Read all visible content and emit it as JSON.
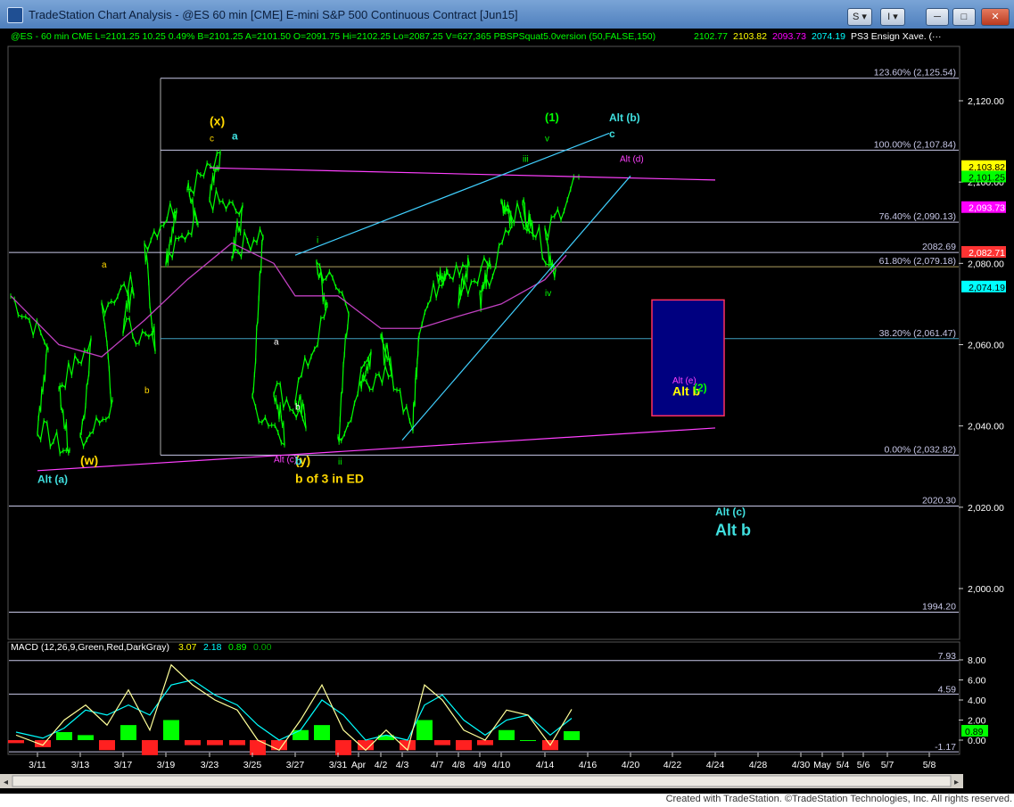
{
  "window": {
    "title": "TradeStation Chart Analysis - @ES 60 min [CME] E-mini S&P 500 Continuous Contract [Jun15]",
    "buttons": {
      "s_label": "S",
      "i_label": "I"
    },
    "colors": {
      "titlebar": "#5b8bc7",
      "background": "#000000"
    }
  },
  "status_line": [
    {
      "text": "@ES - 60 min  CME  L=2101.25  10.25  0.49%  B=2101.25  A=2101.50  O=2091.75  Hi=2102.25  Lo=2087.25  V=627,365  PBSPSquat5.0version (50,FALSE,150)",
      "color": "#00ff00"
    },
    {
      "text": "2102.77",
      "color": "#00ff00"
    },
    {
      "text": "2103.82",
      "color": "#ffff00"
    },
    {
      "text": "2093.73",
      "color": "#ff00ff"
    },
    {
      "text": "2074.19",
      "color": "#00ffff"
    },
    {
      "text": "PS3 Ensign Xave. (···",
      "color": "#ffffff"
    }
  ],
  "chart_data": [
    {
      "type": "candlestick-line",
      "title": "@ES 60 min [CME] E-mini S&P 500 Continuous Contract [Jun15]",
      "ylim": [
        1990,
        2135
      ],
      "y_ticks": [
        2000,
        2020,
        2040,
        2060,
        2080,
        2100,
        2120
      ],
      "y_tick_labels": [
        "2,000.00",
        "2,020.00",
        "2,040.00",
        "2,060.00",
        "2,080.00",
        "2,100.00",
        "2,120.00"
      ],
      "x_ticks": [
        "3/11",
        "3/13",
        "3/17",
        "3/19",
        "3/23",
        "3/25",
        "3/27",
        "3/31",
        "Apr",
        "4/2",
        "4/3",
        "4/7",
        "4/8",
        "4/9",
        "4/10",
        "4/14",
        "4/16",
        "4/20",
        "4/22",
        "4/24",
        "4/28",
        "4/30",
        "May",
        "5/4",
        "5/6",
        "5/7",
        "5/8"
      ],
      "price_path": {
        "x": [
          "3/10",
          "3/11",
          "3/11",
          "3/12",
          "3/12",
          "3/13",
          "3/13",
          "3/16",
          "3/16",
          "3/17",
          "3/17",
          "3/18",
          "3/18",
          "3/19",
          "3/19",
          "3/20",
          "3/20",
          "3/23",
          "3/23",
          "3/24",
          "3/24",
          "3/25",
          "3/25",
          "3/26",
          "3/26",
          "3/27",
          "3/27",
          "3/30",
          "3/30",
          "3/31",
          "3/31",
          "4/1",
          "4/1",
          "4/2",
          "4/2",
          "4/3",
          "4/6",
          "4/7",
          "4/7",
          "4/8",
          "4/8",
          "4/9",
          "4/9",
          "4/10",
          "4/10",
          "4/13",
          "4/13",
          "4/14",
          "4/14",
          "4/15"
        ],
        "y": [
          2072,
          2060,
          2040,
          2033,
          2050,
          2060,
          2035,
          2045,
          2070,
          2075,
          2065,
          2060,
          2085,
          2095,
          2080,
          2092,
          2098,
          2105,
          2096,
          2092,
          2083,
          2088,
          2045,
          2038,
          2050,
          2041,
          2048,
          2068,
          2080,
          2070,
          2035,
          2058,
          2050,
          2055,
          2060,
          2040,
          2065,
          2080,
          2075,
          2080,
          2072,
          2082,
          2070,
          2090,
          2096,
          2088,
          2094,
          2078,
          2086,
          2101.25
        ]
      },
      "moving_average": {
        "name": "PBSPSquat5.0version (50,FALSE,150)",
        "x": [
          "3/10",
          "3/12",
          "3/16",
          "3/18",
          "3/20",
          "3/24",
          "3/26",
          "3/27",
          "3/31",
          "4/2",
          "4/6",
          "4/8",
          "4/10",
          "4/14",
          "4/15"
        ],
        "y": [
          2072,
          2060,
          2057,
          2066,
          2076,
          2085,
          2080,
          2072,
          2072,
          2064,
          2064,
          2067,
          2070,
          2076,
          2082
        ]
      },
      "fib_levels": [
        {
          "label": "123.60% (2,125.54)",
          "value": 2125.54
        },
        {
          "label": "100.00% (2,107.84)",
          "value": 2107.84
        },
        {
          "label": "76.40% (2,090.13)",
          "value": 2090.13
        },
        {
          "label": "61.80% (2,079.18)",
          "value": 2079.18
        },
        {
          "label": "38.20% (2,061.47)",
          "value": 2061.47
        },
        {
          "label": "0.00% (2,032.82)",
          "value": 2032.82
        }
      ],
      "horizontal_levels": [
        {
          "label": "2082.69",
          "value": 2082.69
        },
        {
          "label": "2020.30",
          "value": 2020.3
        },
        {
          "label": "1994.20",
          "value": 1994.2
        }
      ],
      "trendlines": [
        {
          "color": "#ff40ff",
          "from": [
            "3/23",
            2103.5
          ],
          "to": [
            "4/24",
            2100.5
          ]
        },
        {
          "color": "#ff40ff",
          "from": [
            "3/11",
            2029
          ],
          "to": [
            "4/24",
            2039.5
          ]
        },
        {
          "color": "#40d0ff",
          "from": [
            "3/27",
            2082
          ],
          "to": [
            "4/17",
            2112
          ]
        },
        {
          "color": "#40d0ff",
          "from": [
            "4/3",
            2036.5
          ],
          "to": [
            "4/20",
            2101.5
          ]
        }
      ],
      "target_box": {
        "x": [
          "4/21",
          "4/25"
        ],
        "y": [
          2042.5,
          2071
        ],
        "fill": "#000080",
        "border": "#ff3060"
      },
      "price_tags": [
        {
          "label": "2,103.82",
          "value": 2103.82,
          "bg": "#ffff00",
          "fg": "#000000"
        },
        {
          "label": "2,101.25",
          "value": 2101.25,
          "bg": "#00ff00",
          "fg": "#000000"
        },
        {
          "label": "2,093.73",
          "value": 2093.73,
          "bg": "#ff00ff",
          "fg": "#ffffff"
        },
        {
          "label": "2,082.71",
          "value": 2082.71,
          "bg": "#ff3333",
          "fg": "#ffffff"
        },
        {
          "label": "2,074.19",
          "value": 2074.19,
          "bg": "#00ffff",
          "fg": "#000000"
        }
      ],
      "annotations": [
        {
          "text": "(x)",
          "color": "#ffd700",
          "x": "3/23",
          "y": 2114,
          "size": 14,
          "bold": true
        },
        {
          "text": "c",
          "color": "#ffd700",
          "x": "3/23",
          "y": 2110,
          "size": 10
        },
        {
          "text": "a",
          "color": "#40e0e0",
          "x": "3/24",
          "y": 2110.5,
          "size": 12,
          "bold": true
        },
        {
          "text": "(1)",
          "color": "#00ff00",
          "x": "4/14",
          "y": 2115,
          "size": 13,
          "bold": true
        },
        {
          "text": "v",
          "color": "#00ff00",
          "x": "4/14",
          "y": 2110,
          "size": 10
        },
        {
          "text": "Alt (b)",
          "color": "#40e0e0",
          "x": "4/17",
          "y": 2115,
          "size": 12,
          "bold": true
        },
        {
          "text": "c",
          "color": "#40e0e0",
          "x": "4/17",
          "y": 2111,
          "size": 12,
          "bold": true
        },
        {
          "text": "Alt (d)",
          "color": "#ff40ff",
          "x": "4/18",
          "y": 2105,
          "size": 10
        },
        {
          "text": "iii",
          "color": "#00ff00",
          "x": "4/13",
          "y": 2105,
          "size": 10
        },
        {
          "text": "i",
          "color": "#00ff00",
          "x": "3/30",
          "y": 2085,
          "size": 10
        },
        {
          "text": "a",
          "color": "#ffd700",
          "x": "3/16",
          "y": 2079,
          "size": 10
        },
        {
          "text": "b",
          "color": "#ffd700",
          "x": "3/18",
          "y": 2048,
          "size": 10
        },
        {
          "text": "a",
          "color": "#ffffff",
          "x": "3/26",
          "y": 2060,
          "size": 10
        },
        {
          "text": "b",
          "color": "#ffffff",
          "x": "3/27",
          "y": 2044,
          "size": 10
        },
        {
          "text": "iv",
          "color": "#00ff00",
          "x": "4/14",
          "y": 2072,
          "size": 10
        },
        {
          "text": "ii",
          "color": "#00ff00",
          "x": "3/31",
          "y": 2030.5,
          "size": 10
        },
        {
          "text": "Alt (e)",
          "color": "#ff40ff",
          "x": "4/22",
          "y": 2050.5,
          "size": 10
        },
        {
          "text": "Alt b",
          "color": "#ffff00",
          "x": "4/22",
          "y": 2047.5,
          "size": 14,
          "bold": true
        },
        {
          "text": "(2)",
          "color": "#00ff00",
          "x": "4/23",
          "y": 2048.5,
          "size": 12,
          "bold": true
        },
        {
          "text": "(w)",
          "color": "#ffd700",
          "x": "3/13",
          "y": 2030.5,
          "size": 14,
          "bold": true
        },
        {
          "text": "Alt (a)",
          "color": "#40e0e0",
          "x": "3/11",
          "y": 2026,
          "size": 12,
          "bold": true
        },
        {
          "text": "Alt (c)",
          "color": "#ff40ff",
          "x": "3/26",
          "y": 2031,
          "size": 10
        },
        {
          "text": "(y)",
          "color": "#ffd700",
          "x": "3/27",
          "y": 2030.5,
          "size": 14,
          "bold": true
        },
        {
          "text": "b",
          "color": "#40e0e0",
          "x": "3/27",
          "y": 2030.5,
          "size": 12,
          "bold": true
        },
        {
          "text": "b of 3 in ED",
          "color": "#ffd700",
          "x": "3/27",
          "y": 2026,
          "size": 14,
          "bold": true
        },
        {
          "text": "Alt (c)",
          "color": "#40e0e0",
          "x": "4/24",
          "y": 2018,
          "size": 12,
          "bold": true
        },
        {
          "text": "Alt b",
          "color": "#40e0e0",
          "x": "4/24",
          "y": 2013,
          "size": 18,
          "bold": true
        }
      ]
    },
    {
      "type": "macd",
      "title": "MACD (12,26,9,Green,Red,DarkGray)",
      "values": {
        "macd": 3.07,
        "signal": 2.18,
        "diff": 0.89,
        "zero": 0.0
      },
      "value_labels": [
        "3.07",
        "2.18",
        "0.89",
        "0.00"
      ],
      "value_colors": [
        "#ffff00",
        "#00ffff",
        "#00ff00",
        "#00aa00"
      ],
      "ylim": [
        -1.17,
        9.5
      ],
      "y_ticks": [
        0,
        2,
        4,
        6,
        8
      ],
      "y_tick_labels": [
        "0.00",
        "2.00",
        "4.00",
        "6.00",
        "8.00"
      ],
      "reference_levels": [
        {
          "label": "7.93",
          "value": 7.93
        },
        {
          "label": "4.59",
          "value": 4.59
        },
        {
          "label": "-1.17",
          "value": -1.17
        }
      ],
      "last_value_tag": {
        "label": "0.89",
        "bg": "#00ff00"
      },
      "macd_line": {
        "x": [
          "3/10",
          "3/11",
          "3/12",
          "3/13",
          "3/16",
          "3/17",
          "3/18",
          "3/19",
          "3/20",
          "3/23",
          "3/24",
          "3/25",
          "3/26",
          "3/27",
          "3/30",
          "3/31",
          "4/1",
          "4/2",
          "4/3",
          "4/6",
          "4/7",
          "4/8",
          "4/9",
          "4/10",
          "4/13",
          "4/14",
          "4/15"
        ],
        "y": [
          0.5,
          -0.5,
          2.0,
          3.5,
          1.5,
          5.0,
          1.0,
          7.5,
          5.5,
          4.0,
          3.0,
          0.0,
          -1.0,
          2.0,
          5.5,
          1.0,
          -1.0,
          1.0,
          -1.0,
          5.5,
          4.0,
          1.0,
          0.0,
          3.0,
          2.5,
          -0.5,
          3.07
        ]
      },
      "signal_line": {
        "x": [
          "3/10",
          "3/11",
          "3/12",
          "3/13",
          "3/16",
          "3/17",
          "3/18",
          "3/19",
          "3/20",
          "3/23",
          "3/24",
          "3/25",
          "3/26",
          "3/27",
          "3/30",
          "3/31",
          "4/1",
          "4/2",
          "4/3",
          "4/6",
          "4/7",
          "4/8",
          "4/9",
          "4/10",
          "4/13",
          "4/14",
          "4/15"
        ],
        "y": [
          0.8,
          0.2,
          1.2,
          3.0,
          2.5,
          3.5,
          2.5,
          5.5,
          6.0,
          4.5,
          3.5,
          1.5,
          0.0,
          1.0,
          4.0,
          2.5,
          0.0,
          0.5,
          0.0,
          3.5,
          4.5,
          2.0,
          0.5,
          2.0,
          2.5,
          0.5,
          2.18
        ]
      },
      "histogram": {
        "x": [
          "3/10",
          "3/11",
          "3/12",
          "3/13",
          "3/16",
          "3/17",
          "3/18",
          "3/19",
          "3/20",
          "3/23",
          "3/24",
          "3/25",
          "3/26",
          "3/27",
          "3/30",
          "3/31",
          "4/1",
          "4/2",
          "4/3",
          "4/6",
          "4/7",
          "4/8",
          "4/9",
          "4/10",
          "4/13",
          "4/14",
          "4/15"
        ],
        "y": [
          -0.3,
          -0.7,
          0.8,
          0.5,
          -1.0,
          1.5,
          -1.5,
          2.0,
          -0.5,
          -0.5,
          -0.5,
          -1.5,
          -1.0,
          1.0,
          1.5,
          -1.5,
          -1.0,
          0.5,
          -1.0,
          2.0,
          -0.5,
          -1.0,
          -0.5,
          1.0,
          0.0,
          -1.0,
          0.89
        ]
      }
    }
  ],
  "footer": {
    "text": "Created with TradeStation. ©TradeStation Technologies, Inc. All rights reserved."
  }
}
